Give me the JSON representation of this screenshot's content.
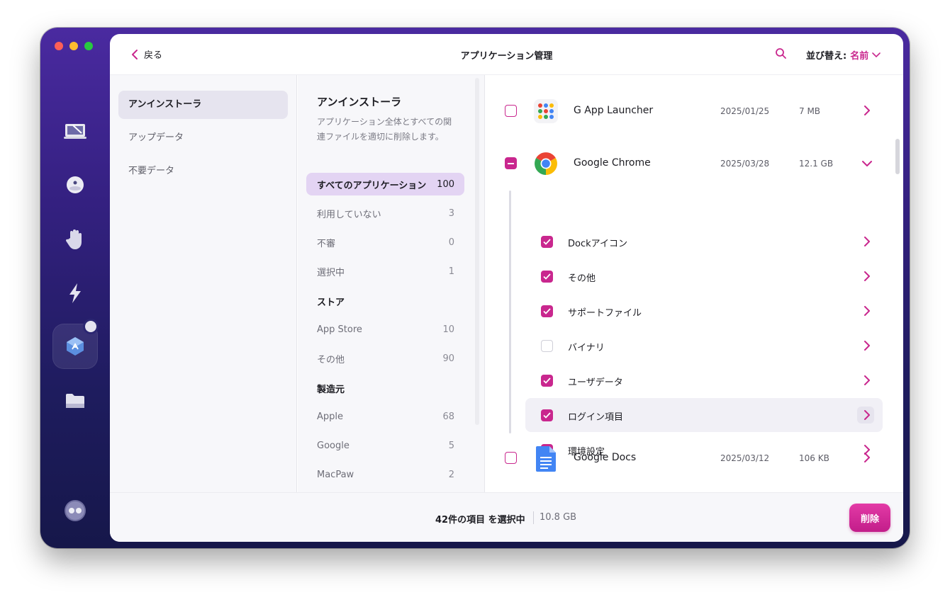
{
  "window": {
    "title": "アプリケーション管理",
    "back_label": "戻る",
    "sort_label": "並び替え:",
    "sort_value": "名前",
    "accent_color": "#c9278e"
  },
  "rail": {
    "icons": [
      "cleanup-icon",
      "protection-icon",
      "privacy-hand-icon",
      "speed-icon",
      "applications-icon",
      "files-icon",
      "assistant-icon"
    ],
    "active": "applications-icon"
  },
  "sidebar": {
    "items": [
      {
        "label": "アンインストーラ",
        "active": true
      },
      {
        "label": "アップデータ",
        "active": false
      },
      {
        "label": "不要データ",
        "active": false
      }
    ]
  },
  "categories": {
    "title": "アンインストーラ",
    "description": "アプリケーション全体とすべての関連ファイルを適切に削除します。",
    "filters": [
      {
        "label": "すべてのアプリケーション",
        "count": "100"
      },
      {
        "label": "利用していない",
        "count": "3"
      },
      {
        "label": "不審",
        "count": "0"
      },
      {
        "label": "選択中",
        "count": "1"
      }
    ],
    "store_heading": "ストア",
    "stores": [
      {
        "label": "App Store",
        "count": "10"
      },
      {
        "label": "その他",
        "count": "90"
      }
    ],
    "vendor_heading": "製造元",
    "vendors": [
      {
        "label": "Apple",
        "count": "68"
      },
      {
        "label": "Google",
        "count": "5"
      },
      {
        "label": "MacPaw",
        "count": "2"
      }
    ]
  },
  "apps": [
    {
      "name": "G App Launcher",
      "date": "2025/01/25",
      "size": "7 MB",
      "state": "unchecked",
      "icon": "app-launcher-icon"
    },
    {
      "name": "Google Chrome",
      "date": "2025/03/28",
      "size": "12.1 GB",
      "state": "mixed",
      "icon": "chrome-icon",
      "expanded": true,
      "items": [
        {
          "label": "Dockアイコン",
          "checked": true
        },
        {
          "label": "その他",
          "checked": true
        },
        {
          "label": "サポートファイル",
          "checked": true
        },
        {
          "label": "バイナリ",
          "checked": false
        },
        {
          "label": "ユーザデータ",
          "checked": true
        },
        {
          "label": "ログイン項目",
          "checked": true
        },
        {
          "label": "環境設定",
          "checked": true
        }
      ]
    },
    {
      "name": "Google Docs",
      "date": "2025/03/12",
      "size": "106 KB",
      "state": "unchecked",
      "icon": "docs-icon"
    }
  ],
  "footer": {
    "selection": "42件の項目 を選択中",
    "total_size": "10.8 GB",
    "delete_label": "削除"
  }
}
